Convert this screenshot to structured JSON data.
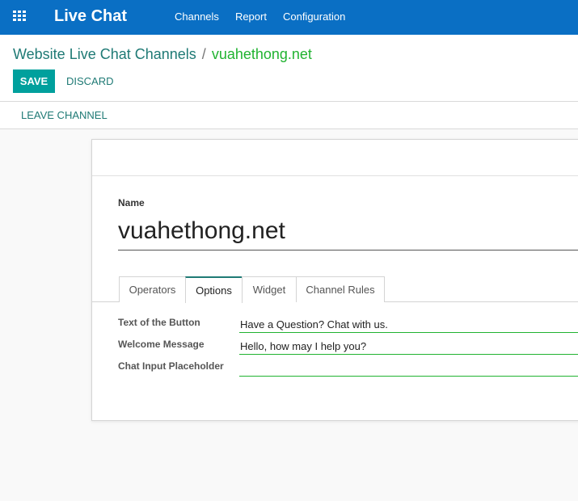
{
  "navbar": {
    "apps_icon": "grid-icon",
    "app_title": "Live Chat",
    "menu": [
      "Channels",
      "Report",
      "Configuration"
    ]
  },
  "breadcrumb": {
    "parent": "Website Live Chat Channels",
    "separator": "/",
    "current": "vuahethong.net"
  },
  "buttons": {
    "save": "SAVE",
    "discard": "DISCARD",
    "leave": "LEAVE CHANNEL"
  },
  "form": {
    "name_label": "Name",
    "name_value": "vuahethong.net",
    "tabs": [
      "Operators",
      "Options",
      "Widget",
      "Channel Rules"
    ],
    "active_tab": "Options",
    "fields": [
      {
        "label": "Text of the Button",
        "value": "Have a Question? Chat with us."
      },
      {
        "label": "Welcome Message",
        "value": "Hello, how may I help you?"
      },
      {
        "label": "Chat Input Placeholder",
        "value": ""
      }
    ]
  },
  "colors": {
    "navbar": "#0a6fc4",
    "primary_button": "#00a09d",
    "link": "#1f7a75",
    "current_breadcrumb": "#21b331",
    "field_underline": "#21b331"
  }
}
